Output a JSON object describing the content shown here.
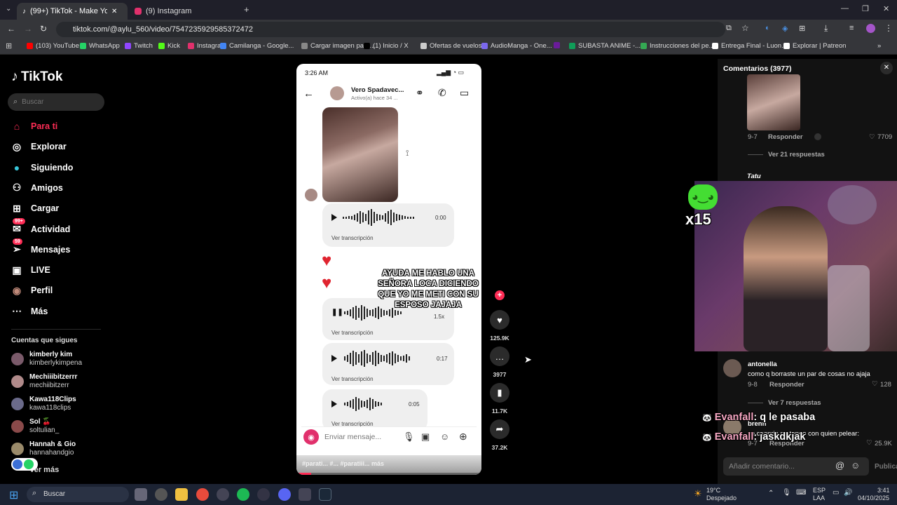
{
  "browser": {
    "tabs": [
      {
        "label": "(99+) TikTok - Make Your D..."
      },
      {
        "label": "(9) Instagram"
      }
    ],
    "url": "tiktok.com/@aylu_560/video/7547235929585372472",
    "bookmarks": [
      {
        "label": "(103) YouTube",
        "color": "#ff0000"
      },
      {
        "label": "WhatsApp",
        "color": "#25d366"
      },
      {
        "label": "Twitch",
        "color": "#9146ff"
      },
      {
        "label": "Kick",
        "color": "#53fc18"
      },
      {
        "label": "Instagram",
        "color": "#e1306c"
      },
      {
        "label": "Camilanga - Google...",
        "color": "#4285f4"
      },
      {
        "label": "Cargar imagen para...",
        "color": "#888888"
      },
      {
        "label": "(1) Inicio / X",
        "color": "#000000"
      },
      {
        "label": "Ofertas de vuelos",
        "color": "#cccccc"
      },
      {
        "label": "AudioManga - One...",
        "color": "#7b68ee"
      },
      {
        "label": "",
        "color": "#6a1b9a"
      },
      {
        "label": "SUBASTA ANIME -...",
        "color": "#0f9d58"
      },
      {
        "label": "Instrucciones del pe...",
        "color": "#34a853"
      },
      {
        "label": "Entrega Final - Luon...",
        "color": "#ffffff"
      },
      {
        "label": "Explorar | Patreon",
        "color": "#ffffff"
      }
    ]
  },
  "tiktok": {
    "logo": "TikTok",
    "search_placeholder": "Buscar",
    "nav": [
      {
        "label": "Para ti",
        "icon": "home-icon",
        "active": true
      },
      {
        "label": "Explorar",
        "icon": "compass-icon"
      },
      {
        "label": "Siguiendo",
        "icon": "following-icon"
      },
      {
        "label": "Amigos",
        "icon": "friends-icon"
      },
      {
        "label": "Cargar",
        "icon": "upload-icon"
      },
      {
        "label": "Actividad",
        "icon": "activity-icon",
        "badge": "99+"
      },
      {
        "label": "Mensajes",
        "icon": "messages-icon",
        "badge": "59"
      },
      {
        "label": "LIVE",
        "icon": "live-icon"
      },
      {
        "label": "Perfil",
        "icon": "profile-icon"
      },
      {
        "label": "Más",
        "icon": "more-icon"
      }
    ],
    "following_title": "Cuentas que sigues",
    "following": [
      {
        "name": "kimberly kim",
        "user": "kimberlykimpena"
      },
      {
        "name": "Mechiiibitzerrr",
        "user": "mechiibitzerr"
      },
      {
        "name": "Kawa118Clips",
        "user": "kawa118clips"
      },
      {
        "name": "Sol 🍒",
        "user": "soltulian_"
      },
      {
        "name": "Hannah & Gio",
        "user": "hannahandgio"
      }
    ],
    "see_more": "Ver más"
  },
  "video": {
    "status_time": "3:26 AM",
    "contact_name": "Vero Spadavec...",
    "contact_status": "Activo(a) hace 34 ...",
    "caption_overlay": "AYUDA ME HABLO UNA SEÑORA LOCA DICIENDO QUE YO ME METI CON SU ESPOSO JAJAJA",
    "audio": [
      {
        "duration": "0:00",
        "trans": "Ver transcripción"
      },
      {
        "duration": "1.5x",
        "trans": "Ver transcripción"
      },
      {
        "duration": "0:17",
        "trans": "Ver transcripción"
      },
      {
        "duration": "0:05",
        "trans": "Ver transcripción"
      }
    ],
    "message_placeholder": "Enviar mensaje...",
    "hashtags": "#parati... #... #paratiii... más"
  },
  "actions": {
    "likes": "125.9K",
    "comments": "3977",
    "saves": "11.7K",
    "shares": "37.2K"
  },
  "comments": {
    "title": "Comentarios (3977)",
    "items": [
      {
        "meta": "9-7",
        "reply": "Responder",
        "likes": "7709",
        "view_replies": "Ver 21 respuestas"
      },
      {
        "name": "antonella",
        "text": "como q borraste un par de cosas no ajaja",
        "meta": "9-8",
        "reply": "Responder",
        "likes": "128",
        "view_replies": "Ver 7 respuestas"
      },
      {
        "name": "brenn",
        "text": "yo cuando no tengo con quien pelear:",
        "meta": "9-7",
        "reply": "Responder",
        "likes": "25.9K"
      }
    ],
    "partial_name": "Tatu",
    "input_placeholder": "Añadir comentario...",
    "publish": "Publicar"
  },
  "overlay": {
    "multiplier": "x15",
    "chat": [
      {
        "name": "Evanfall",
        "msg": ": q le pasaba"
      },
      {
        "name": "Evanfall",
        "msg": ": jaskdkjak"
      }
    ]
  },
  "taskbar": {
    "search": "Buscar",
    "weather_temp": "19°C",
    "weather_desc": "Despejado",
    "lang1": "ESP",
    "lang2": "LAA",
    "time": "3:41",
    "date": "04/10/2025"
  }
}
